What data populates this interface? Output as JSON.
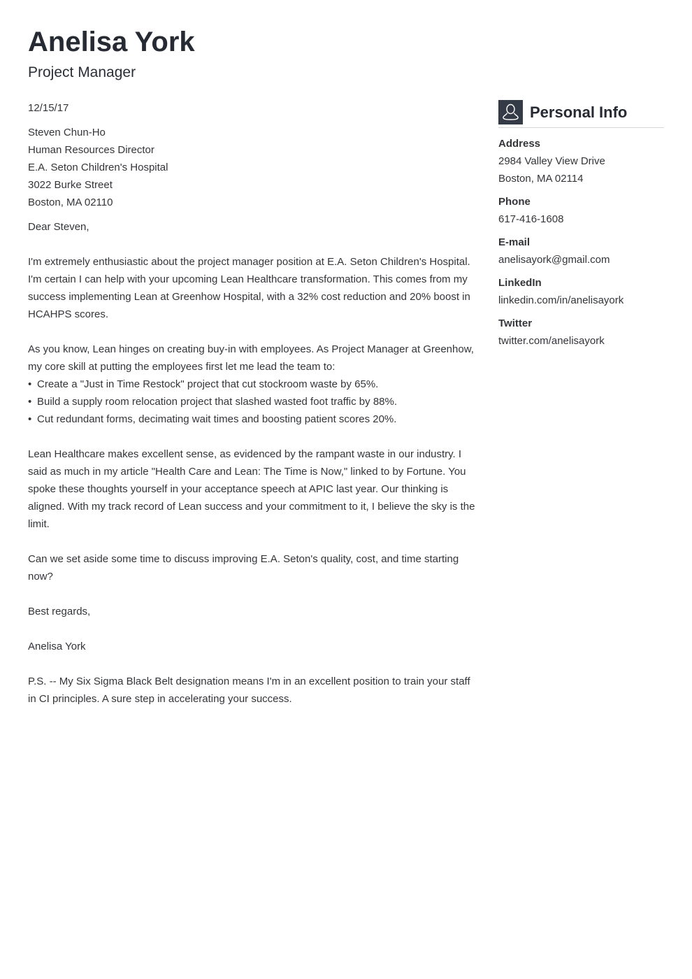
{
  "header": {
    "name": "Anelisa York",
    "job_title": "Project Manager"
  },
  "letter": {
    "date": "12/15/17",
    "recipient": [
      "Steven Chun-Ho",
      "Human Resources Director",
      "E.A. Seton Children's Hospital",
      "3022 Burke Street",
      "Boston, MA 02110"
    ],
    "greeting": "Dear Steven,",
    "paragraph_1": "I'm extremely enthusiastic about the project manager position at E.A. Seton Children's Hospital. I'm certain I can help with your upcoming Lean Healthcare transformation. This comes from my success implementing Lean at Greenhow Hospital, with a 32% cost reduction and 20% boost in HCAHPS scores.",
    "paragraph_2": "As you know, Lean hinges on creating buy-in with employees. As Project Manager at Greenhow, my core skill at putting the employees first let me lead the team to:",
    "bullets": [
      "Create a \"Just in Time Restock\" project that cut stockroom waste by 65%.",
      "Build a supply room relocation project that slashed wasted foot traffic by 88%.",
      "Cut redundant forms, decimating wait times and boosting patient scores 20%."
    ],
    "paragraph_3": "Lean Healthcare makes excellent sense, as evidenced by the rampant waste in our industry. I said as much in my article \"Health Care and Lean: The Time is Now,\" linked to by Fortune. You spoke these thoughts yourself in your acceptance speech at APIC last year. Our thinking is aligned. With my track record of Lean success and your commitment to it, I believe the sky is the limit.",
    "paragraph_4": "Can we set aside some time to discuss improving E.A. Seton's quality, cost, and time starting now?",
    "closing": "Best regards,",
    "signature": "Anelisa York",
    "postscript": "P.S. -- My Six Sigma Black Belt designation means I'm in an excellent position to train your staff in CI principles. A sure step in accelerating your success."
  },
  "sidebar": {
    "title": "Personal Info",
    "icon": "user-icon",
    "accent_color": "#343a46",
    "address_label": "Address",
    "address_lines": [
      "2984 Valley View Drive",
      "Boston, MA 02114"
    ],
    "phone_label": "Phone",
    "phone": "617-416-1608",
    "email_label": "E-mail",
    "email": "anelisayork@gmail.com",
    "linkedin_label": "LinkedIn",
    "linkedin": "linkedin.com/in/anelisayork",
    "twitter_label": "Twitter",
    "twitter": "twitter.com/anelisayork"
  }
}
